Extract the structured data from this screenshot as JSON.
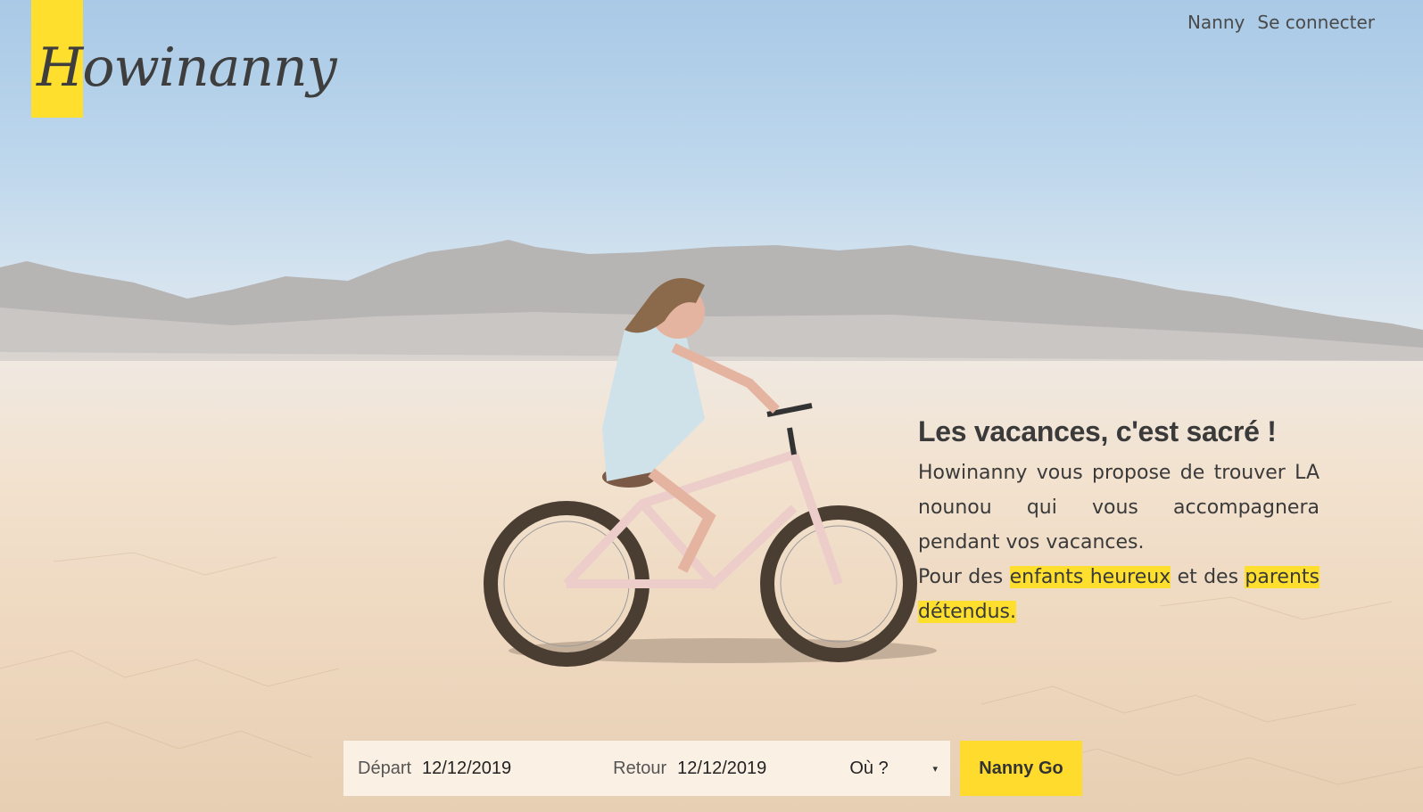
{
  "brand": {
    "name": "Howinanny",
    "accent": "#fedf2e"
  },
  "nav": {
    "items": [
      "Nanny",
      "Se connecter"
    ]
  },
  "hero": {
    "title": "Les vacances, c'est sacré !",
    "line1": "Howinanny vous propose de trouver LA nounou qui vous accompagnera pendant vos vacances.",
    "line2_a": "Pour des ",
    "line2_hl1": "enfants heureux",
    "line2_b": " et des ",
    "line2_hl2": "parents détendus."
  },
  "search": {
    "depart_label": "Départ",
    "depart_value": "12/12/2019",
    "retour_label": "Retour",
    "retour_value": "12/12/2019",
    "where_value": "Où ?",
    "caret_icon": "▾",
    "submit_label": "Nanny Go"
  }
}
